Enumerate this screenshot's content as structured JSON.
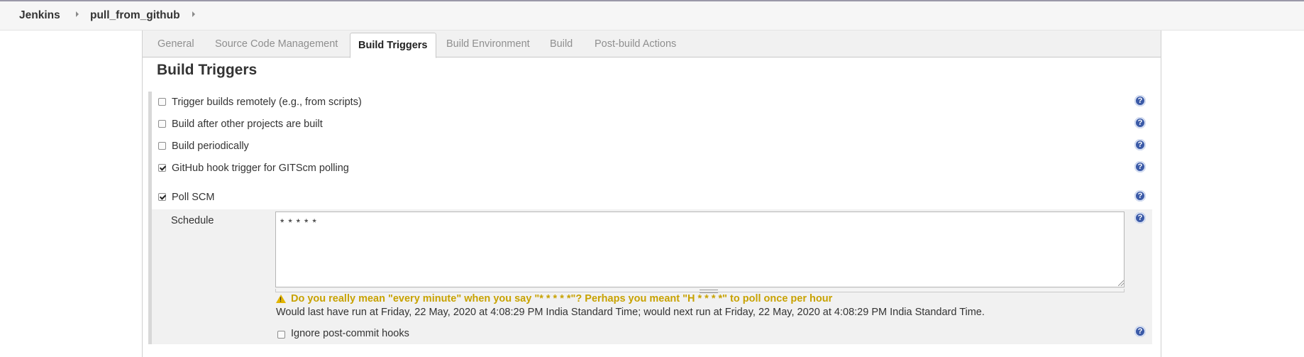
{
  "breadcrumb": {
    "items": [
      "Jenkins",
      "pull_from_github"
    ]
  },
  "tabs": {
    "general": "General",
    "scm": "Source Code Management",
    "build_triggers": "Build Triggers",
    "build_env": "Build Environment",
    "build": "Build",
    "post_build": "Post-build Actions",
    "active": "Build Triggers"
  },
  "section": {
    "title": "Build Triggers"
  },
  "triggers": [
    {
      "label": "Trigger builds remotely (e.g., from scripts)",
      "checked": false
    },
    {
      "label": "Build after other projects are built",
      "checked": false
    },
    {
      "label": "Build periodically",
      "checked": false
    },
    {
      "label": "GitHub hook trigger for GITScm polling",
      "checked": true
    },
    {
      "label": "Poll SCM",
      "checked": true
    }
  ],
  "poll_scm": {
    "schedule_label": "Schedule",
    "schedule_value": "* * * * *",
    "warning": "Do you really mean \"every minute\" when you say \"* * * * *\"? Perhaps you meant \"H * * * *\" to poll once per hour",
    "info": "Would last have run at Friday, 22 May, 2020 at 4:08:29 PM India Standard Time; would next run at Friday, 22 May, 2020 at 4:08:29 PM India Standard Time.",
    "ignore_hooks_label": "Ignore post-commit hooks",
    "ignore_hooks_checked": false
  },
  "icons": {
    "help": "help-icon",
    "warning": "warning-icon",
    "breadcrumb_separator": "chevron-right-icon"
  },
  "colors": {
    "warning_text": "#c8a200",
    "help_icon": "#3b5aa7",
    "tab_active_text": "#222222",
    "tab_inactive_text": "#8f8f8f"
  }
}
